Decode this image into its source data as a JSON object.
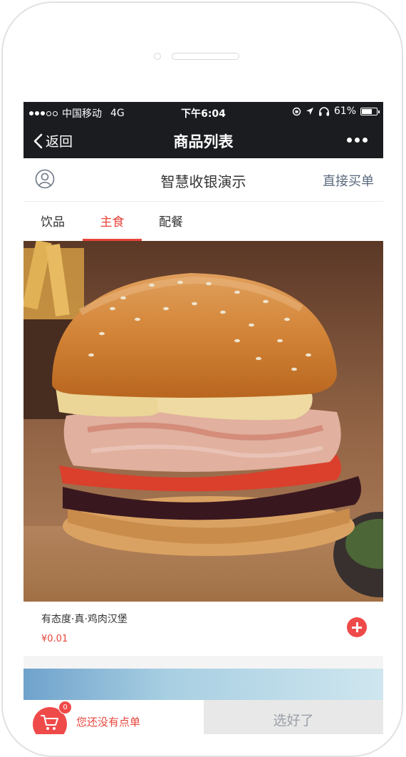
{
  "status_bar": {
    "carrier": "中国移动",
    "network": "4G",
    "time": "下午6:04",
    "battery": "61%",
    "icons": [
      "signal-dots-icon",
      "orientation-lock-icon",
      "location-icon",
      "headphones-icon",
      "battery-icon"
    ]
  },
  "nav": {
    "back_label": "返回",
    "title": "商品列表",
    "more_icon": "more-dots-icon"
  },
  "store": {
    "name": "智慧收银演示",
    "direct_buy": "直接买单",
    "user_icon": "user-profile-icon"
  },
  "tabs": [
    {
      "label": "饮品",
      "active": false
    },
    {
      "label": "主食",
      "active": true
    },
    {
      "label": "配餐",
      "active": false
    }
  ],
  "products": [
    {
      "name": "有态度·真·鸡肉汉堡",
      "price": "¥0.01",
      "image": "burger-photo"
    }
  ],
  "cart": {
    "count": "0",
    "message": "您还没有点单",
    "submit_label": "选好了"
  },
  "colors": {
    "accent": "#e8453c",
    "header_bg": "#1b1c20",
    "submit_bg": "#e8e8e8"
  }
}
